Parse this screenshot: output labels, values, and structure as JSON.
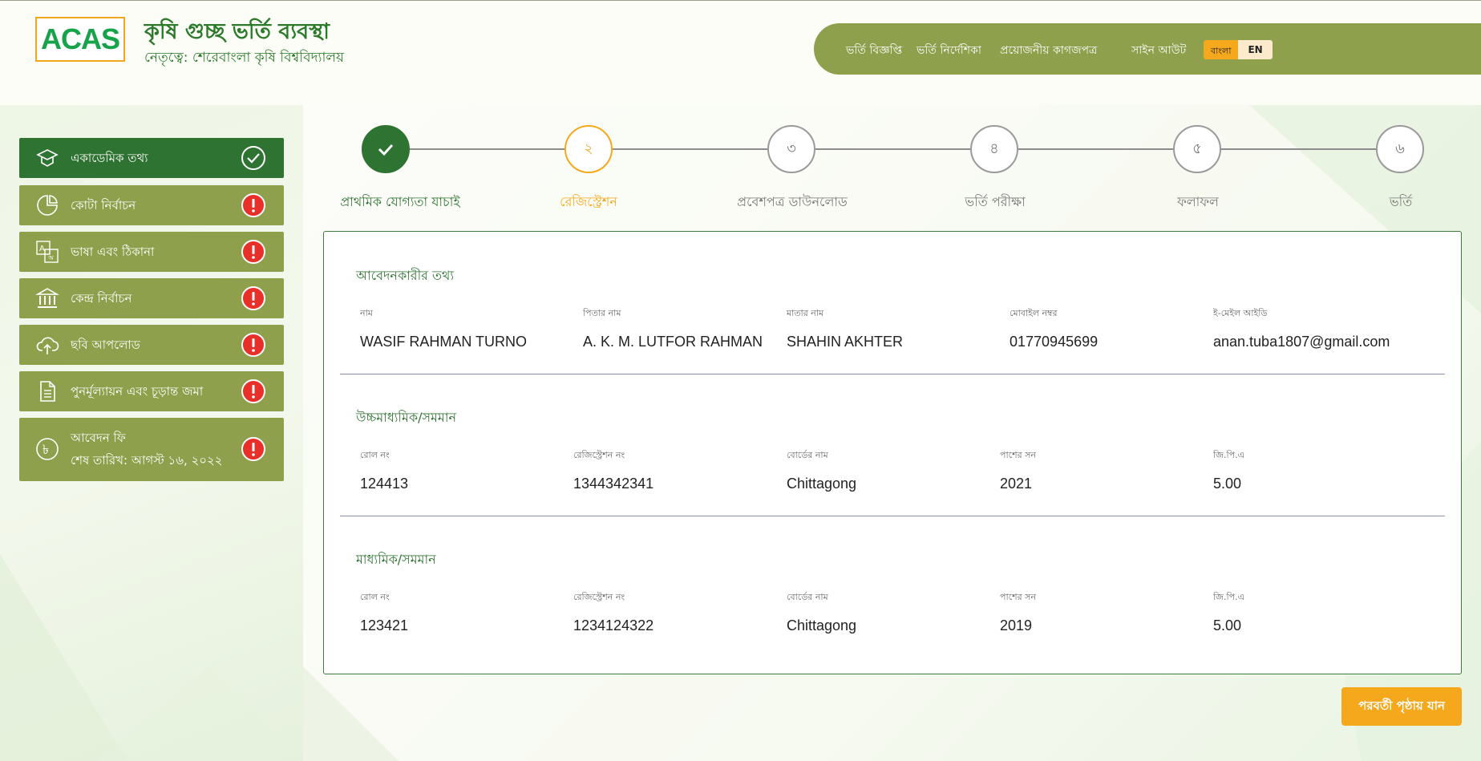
{
  "header": {
    "logo_text": "ACAS",
    "title": "কৃষি গুচ্ছ ভর্তি ব্যবস্থা",
    "subtitle": "নেতৃত্বে: শেরেবাংলা কৃষি বিশ্ববিদ্যালয়"
  },
  "nav": {
    "links": [
      "ভর্তি বিজ্ঞপ্তি",
      "ভর্তি নির্দেশিকা",
      "প্রয়োজনীয় কাগজপত্র",
      "সাইন আউট"
    ],
    "lang_bn": "বাংলা",
    "lang_en": "EN"
  },
  "sidebar": {
    "items": [
      {
        "label": "একাডেমিক তথ্য",
        "status": "complete",
        "icon": "graduation-cap-icon"
      },
      {
        "label": "কোটা নির্বাচন",
        "status": "incomplete",
        "icon": "pie-chart-icon"
      },
      {
        "label": "ভাষা এবং ঠিকানা",
        "status": "incomplete",
        "icon": "translate-icon"
      },
      {
        "label": "কেন্দ্র নির্বাচন",
        "status": "incomplete",
        "icon": "bank-icon"
      },
      {
        "label": "ছবি আপলোড",
        "status": "incomplete",
        "icon": "cloud-upload-icon"
      },
      {
        "label": "পুনর্মূল্যায়ন এবং চূড়ান্ত জমা",
        "status": "incomplete",
        "icon": "document-icon"
      },
      {
        "label": "আবেদন ফি",
        "sublabel": "শেষ তারিখ: আগস্ট ১৬, ২০২২",
        "status": "incomplete",
        "icon": "taka-icon"
      }
    ]
  },
  "stepper": {
    "steps": [
      {
        "num": "",
        "label": "প্রাথমিক যোগ্যতা যাচাই",
        "state": "done"
      },
      {
        "num": "২",
        "label": "রেজিস্ট্রেশন",
        "state": "current"
      },
      {
        "num": "৩",
        "label": "প্রবেশপত্র ডাউনলোড",
        "state": "pending"
      },
      {
        "num": "৪",
        "label": "ভর্তি পরীক্ষা",
        "state": "pending"
      },
      {
        "num": "৫",
        "label": "ফলাফল",
        "state": "pending"
      },
      {
        "num": "৬",
        "label": "ভর্তি",
        "state": "pending"
      }
    ]
  },
  "applicant": {
    "title": "আবেদনকারীর তথ্য",
    "labels": [
      "নাম",
      "পিতার নাম",
      "মাতার নাম",
      "মোবাইল নম্বর",
      "ই-মেইল আইডি"
    ],
    "values": [
      "WASIF RAHMAN TURNO",
      "A. K. M. LUTFOR RAHMAN",
      "SHAHIN AKHTER",
      "01770945699",
      "anan.tuba1807@gmail.com"
    ]
  },
  "hsc": {
    "title": "উচ্চমাধ্যমিক/সমমান",
    "labels": [
      "রোল নং",
      "রেজিস্ট্রেশন নং",
      "বোর্ডের নাম",
      "পাশের সন",
      "জি.পি.এ"
    ],
    "values": [
      "124413",
      "1344342341",
      "Chittagong",
      "2021",
      "5.00"
    ]
  },
  "ssc": {
    "title": "মাধ্যমিক/সমমান",
    "labels": [
      "রোল নং",
      "রেজিস্ট্রেশন নং",
      "বোর্ডের নাম",
      "পাশের সন",
      "জি.পি.এ"
    ],
    "values": [
      "123421",
      "1234124322",
      "Chittagong",
      "2019",
      "5.00"
    ]
  },
  "next_button": "পরবর্তী পৃষ্ঠায় যান",
  "colors": {
    "olive": "#8ea04b",
    "dark_green": "#2f7332",
    "orange": "#f5a81c",
    "alert_red": "#e8302a"
  }
}
